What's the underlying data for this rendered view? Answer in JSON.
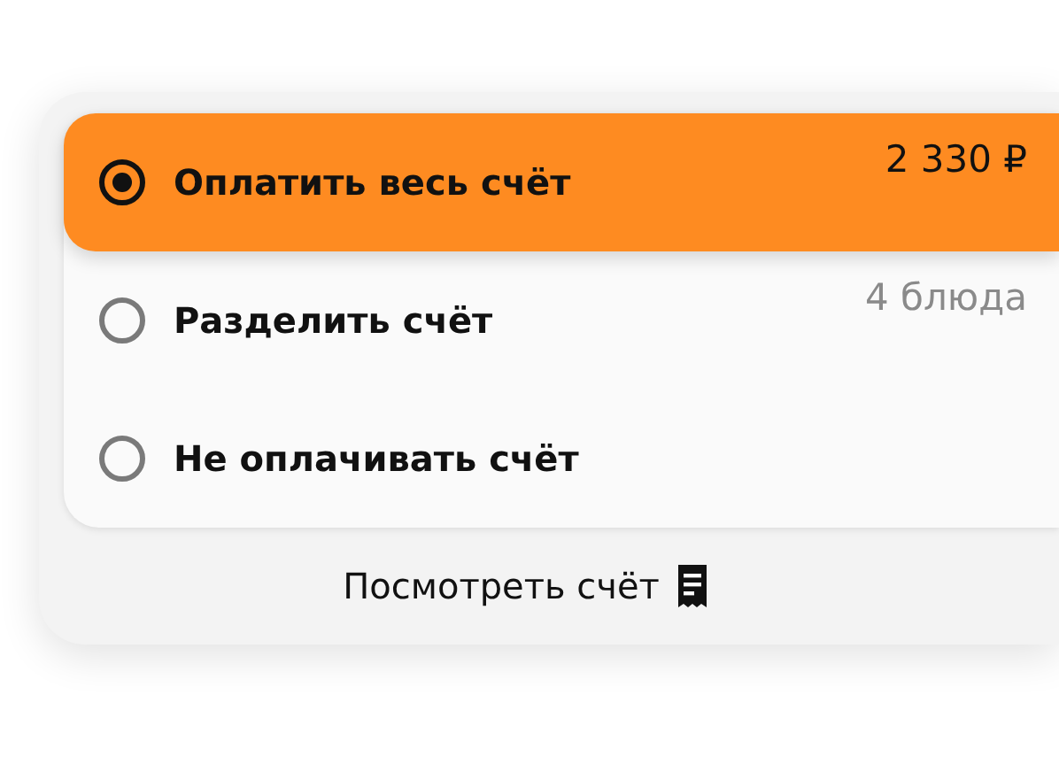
{
  "options": [
    {
      "label": "Оплатить весь счёт",
      "note": "2 330 ₽",
      "selected": true
    },
    {
      "label": "Разделить счёт",
      "note": "4 блюда",
      "selected": false
    },
    {
      "label": "Не оплачивать счёт",
      "selected": false
    }
  ],
  "view_bill": {
    "label": "Посмотреть счёт"
  }
}
